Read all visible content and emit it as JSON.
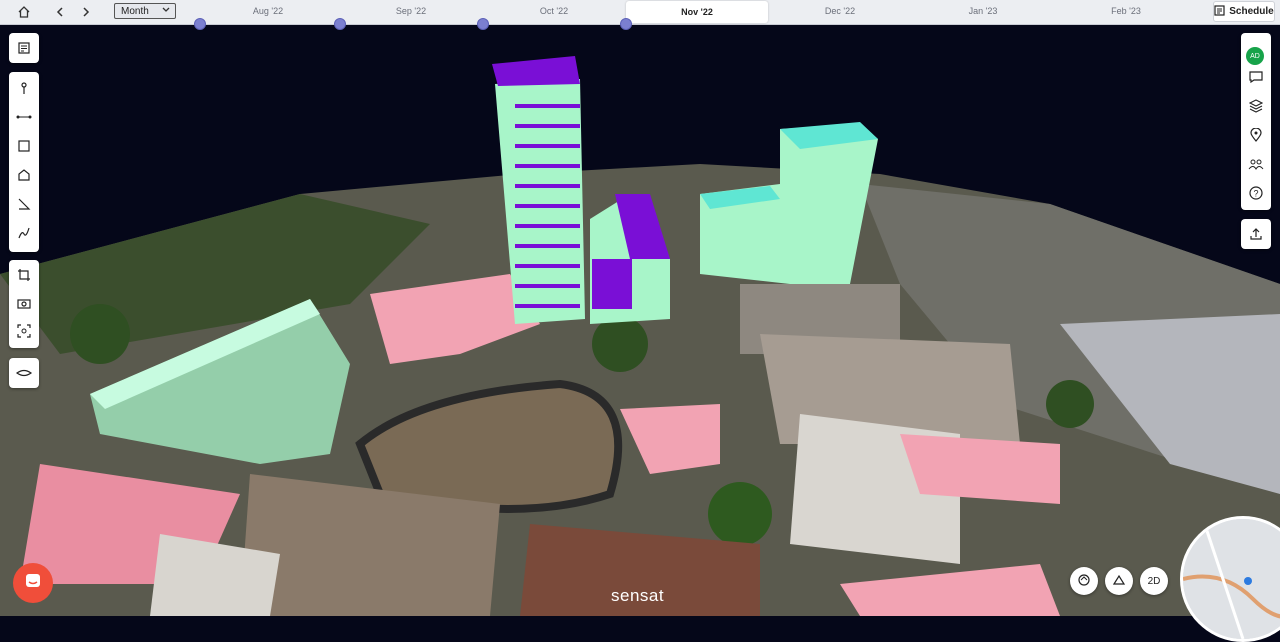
{
  "timeline": {
    "view_mode": "Month",
    "months": [
      "Aug '22",
      "Sep '22",
      "Oct '22",
      "Nov '22",
      "Dec '22",
      "Jan '23",
      "Feb '23"
    ],
    "active_month": "Nov '22",
    "schedule_label": "Schedule"
  },
  "user": {
    "initials": "AD"
  },
  "view_toggle_label": "2D",
  "brand": "sensat",
  "icons": {
    "home": "home-icon",
    "back": "chevron-left-icon",
    "forward": "chevron-right-icon",
    "schedule": "schedule-icon",
    "notes": "notes-icon",
    "pin": "pin-icon",
    "measure": "measure-line-icon",
    "area": "area-icon",
    "volume": "volume-icon",
    "angle": "angle-icon",
    "profile": "profile-icon",
    "crop": "crop-icon",
    "camera": "camera-icon",
    "scan": "scan-icon",
    "hand": "hand-icon",
    "comment": "comment-icon",
    "layers": "layers-icon",
    "location": "location-icon",
    "people": "people-icon",
    "help": "help-icon",
    "export": "upload-icon",
    "orbit": "orbit-icon",
    "pan": "pan-icon",
    "chat": "chat-icon"
  },
  "colors": {
    "accent": "#7b7fd0",
    "proposed_massing": "#a8f5c9",
    "proposed_roof": "#7a0fd6",
    "site_pink": "#f2a3b3",
    "chat": "#f04e3a",
    "avatar": "#17a34a"
  }
}
